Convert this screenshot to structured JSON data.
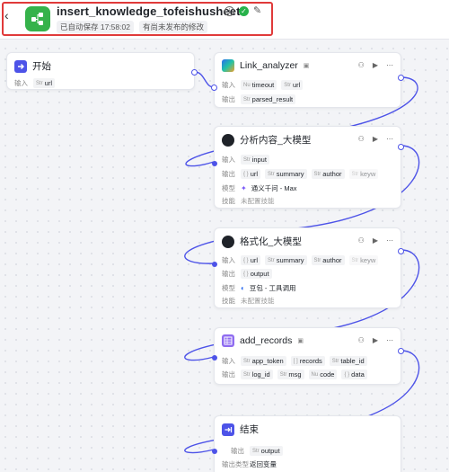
{
  "header": {
    "back_glyph": "‹",
    "title": "insert_knowledge_tofeishusheet",
    "autosave": "已自动保存 17:58:02",
    "unpublished": "有尚未发布的修改"
  },
  "labels": {
    "input": "输入",
    "output": "输出",
    "model": "模型",
    "skill": "技能",
    "output_type": "输出类型"
  },
  "nodes": {
    "start": {
      "title": "开始",
      "inputs": [
        {
          "type": "Str",
          "name": "url"
        }
      ]
    },
    "link_analyzer": {
      "title": "Link_analyzer",
      "inputs": [
        {
          "type": "Nu",
          "name": "timeout"
        },
        {
          "type": "Str",
          "name": "url"
        }
      ],
      "outputs": [
        {
          "type": "Str",
          "name": "parsed_result"
        }
      ]
    },
    "analyze": {
      "title": "分析内容_大模型",
      "inputs": [
        {
          "type": "Str",
          "name": "input"
        }
      ],
      "outputs": [
        {
          "type": "{ }",
          "name": "url"
        },
        {
          "type": "Str",
          "name": "summary"
        },
        {
          "type": "Str",
          "name": "author"
        },
        {
          "type": "Str",
          "name": "keyw"
        }
      ],
      "model": "通义千问 - Max",
      "skill": "未配置技能"
    },
    "format": {
      "title": "格式化_大模型",
      "inputs": [
        {
          "type": "{ }",
          "name": "url"
        },
        {
          "type": "Str",
          "name": "summary"
        },
        {
          "type": "Str",
          "name": "author"
        },
        {
          "type": "Str",
          "name": "keyw"
        }
      ],
      "outputs": [
        {
          "type": "{ }",
          "name": "output"
        }
      ],
      "model": "豆包 - 工具调用",
      "skill": "未配置技能"
    },
    "add_records": {
      "title": "add_records",
      "inputs": [
        {
          "type": "Str",
          "name": "app_token"
        },
        {
          "type": "[ ]",
          "name": "records"
        },
        {
          "type": "Str",
          "name": "table_id"
        }
      ],
      "outputs": [
        {
          "type": "Str",
          "name": "log_id"
        },
        {
          "type": "Str",
          "name": "msg"
        },
        {
          "type": "Nu",
          "name": "code"
        },
        {
          "type": "{ }",
          "name": "data"
        }
      ]
    },
    "end": {
      "title": "结束",
      "outputs": [
        {
          "type": "Str",
          "name": "output"
        }
      ],
      "output_type": "返回变量"
    }
  },
  "colors": {
    "accent": "#4d53e8",
    "brand_green": "#35b24a",
    "highlight_red": "#e03a3a"
  }
}
